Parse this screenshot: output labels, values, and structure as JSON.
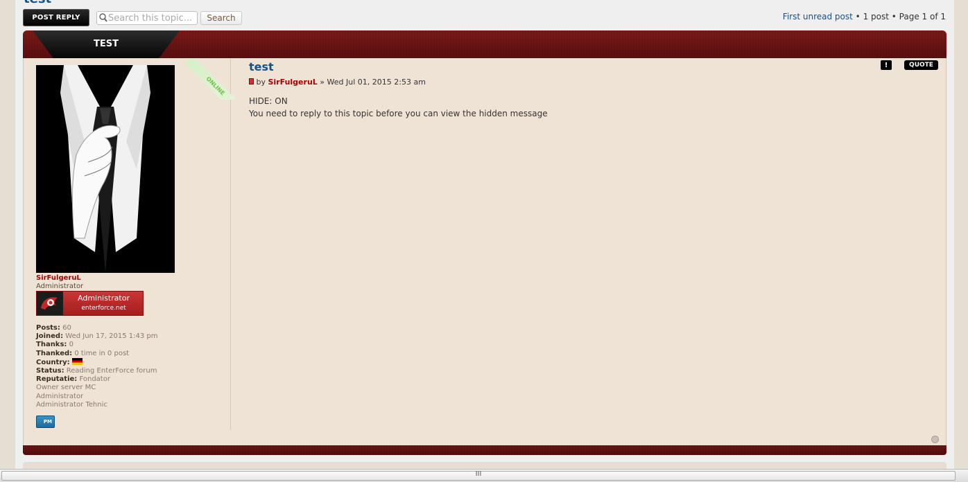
{
  "topic": {
    "title_cut": "test"
  },
  "toolbar": {
    "post_reply_label": "POST REPLY",
    "search_placeholder": "Search this topic...",
    "search_button_label": "Search"
  },
  "pagination": {
    "first_unread": "First unread post",
    "sep1": " • ",
    "posts_count": "1 post",
    "sep2": " • ",
    "page_info": "Page 1 of 1"
  },
  "tab": {
    "label": "TEST"
  },
  "profile": {
    "online_badge": "ONLINE",
    "username": "SirFulgeruL",
    "rank": "Administrator",
    "rank_image_line1": "Administrator",
    "rank_image_line2": "enterforce.net",
    "stats": [
      {
        "label": "Posts:",
        "value": "60"
      },
      {
        "label": "Joined:",
        "value": "Wed Jun 17, 2015 1:43 pm"
      },
      {
        "label": "Thanks:",
        "value": "0"
      },
      {
        "label": "Thanked:",
        "value": "0 time in 0 post"
      },
      {
        "label": "Country:",
        "value": ""
      },
      {
        "label": "Status:",
        "value": "Reading EnterForce forum"
      },
      {
        "label": "Reputatie:",
        "value": "Fondator"
      }
    ],
    "extra_lines": [
      "Owner server MC",
      "Administrator",
      "Administrator Tehnic"
    ],
    "pm_label": "PM"
  },
  "post": {
    "title": "test",
    "by_prefix": "by ",
    "author": "SirFulgeruL",
    "date_prefix": " » ",
    "date": "Wed Jul 01, 2015 2:53 am",
    "content_line1": "HIDE: ON",
    "content_line2": "You need to reply to this topic before you can view the hidden message",
    "report_label": "!",
    "quote_label": "QUOTE"
  },
  "scrollbar": {
    "grip_label": "III"
  },
  "colors": {
    "accent_red": "#7d1a1a",
    "link_blue": "#105289",
    "author_red": "#aa0000",
    "post_bg": "#efe3d6"
  }
}
